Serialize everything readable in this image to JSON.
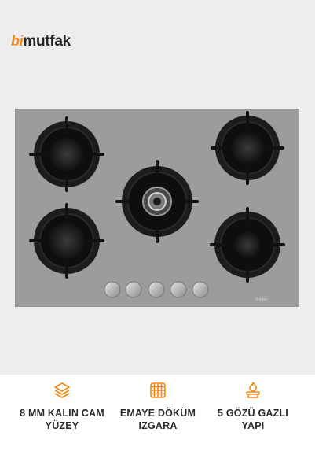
{
  "brand": {
    "prefix": "bi",
    "name": "mutfak",
    "accent_color": "#f08a1a"
  },
  "product": {
    "maker_mark": "Simfer"
  },
  "features": [
    {
      "icon": "layers-icon",
      "line1": "8 MM KALIN CAM",
      "line2": "YÜZEY"
    },
    {
      "icon": "grid-icon",
      "line1": "EMAYE DÖKÜM",
      "line2": "IZGARA"
    },
    {
      "icon": "gas-flame-icon",
      "line1": "5 GÖZÜ GAZLI",
      "line2": "YAPI"
    }
  ]
}
